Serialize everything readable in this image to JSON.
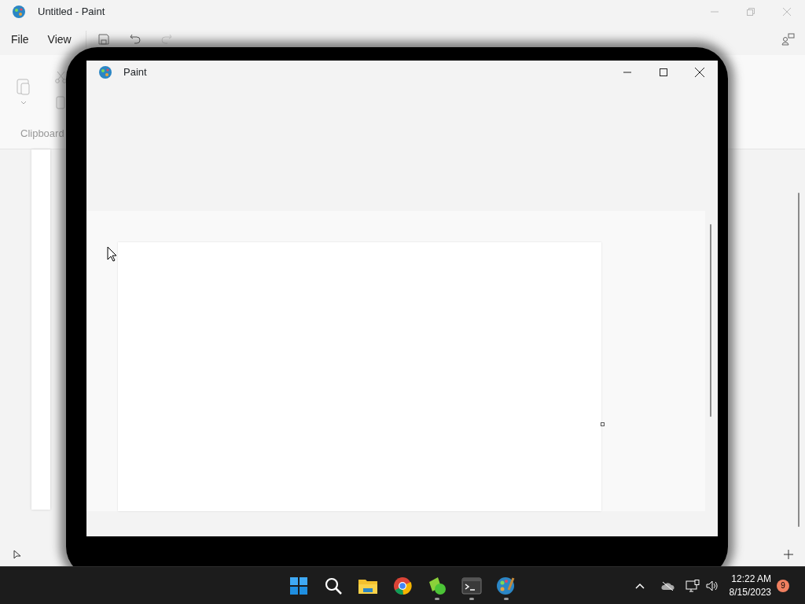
{
  "background_window": {
    "title": "Untitled - Paint",
    "menu": [
      "File",
      "View"
    ],
    "ribbon_group": "Clipboard"
  },
  "front_window": {
    "title": "Paint"
  },
  "taskbar": {
    "apps": [
      {
        "kind": "start",
        "running": false
      },
      {
        "kind": "search",
        "running": false
      },
      {
        "kind": "explorer",
        "running": false
      },
      {
        "kind": "browser",
        "running": false
      },
      {
        "kind": "green",
        "running": true
      },
      {
        "kind": "terminal",
        "running": true
      },
      {
        "kind": "paint",
        "running": true
      }
    ],
    "time": "12:22 AM",
    "date": "8/15/2023",
    "notification_count": "9"
  }
}
